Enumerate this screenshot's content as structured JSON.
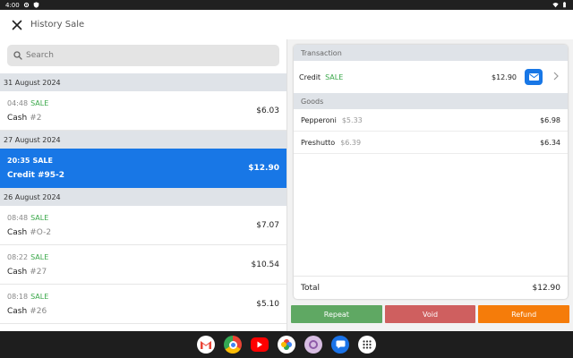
{
  "statusbar": {
    "time": "4:00"
  },
  "appbar": {
    "title": "History Sale"
  },
  "search": {
    "placeholder": "Search"
  },
  "groups": [
    {
      "date": "31 August 2024",
      "sales": [
        {
          "time": "04:48",
          "kind": "SALE",
          "method": "Cash",
          "number": "#2",
          "amount": "$6.03",
          "selected": false
        }
      ]
    },
    {
      "date": "27 August 2024",
      "sales": [
        {
          "time": "20:35",
          "kind": "SALE",
          "method": "Credit",
          "number": "#95-2",
          "amount": "$12.90",
          "selected": true
        }
      ]
    },
    {
      "date": "26 August 2024",
      "sales": [
        {
          "time": "08:48",
          "kind": "SALE",
          "method": "Cash",
          "number": "#O-2",
          "amount": "$7.07",
          "selected": false
        },
        {
          "time": "08:22",
          "kind": "SALE",
          "method": "Cash",
          "number": "#27",
          "amount": "$10.54",
          "selected": false
        },
        {
          "time": "08:18",
          "kind": "SALE",
          "method": "Cash",
          "number": "#26",
          "amount": "$5.10",
          "selected": false
        }
      ]
    }
  ],
  "detail": {
    "transaction_header": "Transaction",
    "transaction": {
      "method": "Credit",
      "kind": "SALE",
      "amount": "$12.90"
    },
    "goods_header": "Goods",
    "goods": [
      {
        "name": "Pepperoni",
        "unit_price": "$5.33",
        "amount": "$6.98"
      },
      {
        "name": "Preshutto",
        "unit_price": "$6.39",
        "amount": "$6.34"
      }
    ],
    "total_label": "Total",
    "total_amount": "$12.90"
  },
  "actions": {
    "repeat": "Repeat",
    "void": "Void",
    "refund": "Refund"
  },
  "colors": {
    "accent": "#1877e6",
    "sale_green": "#3aa84a",
    "repeat": "#5fa863",
    "void": "#cf5f5f",
    "refund": "#f57c0a"
  },
  "taskbar_apps": [
    "gmail-icon",
    "chrome-icon",
    "youtube-icon",
    "photos-icon",
    "camera-icon",
    "messages-icon",
    "app-launcher-icon"
  ]
}
